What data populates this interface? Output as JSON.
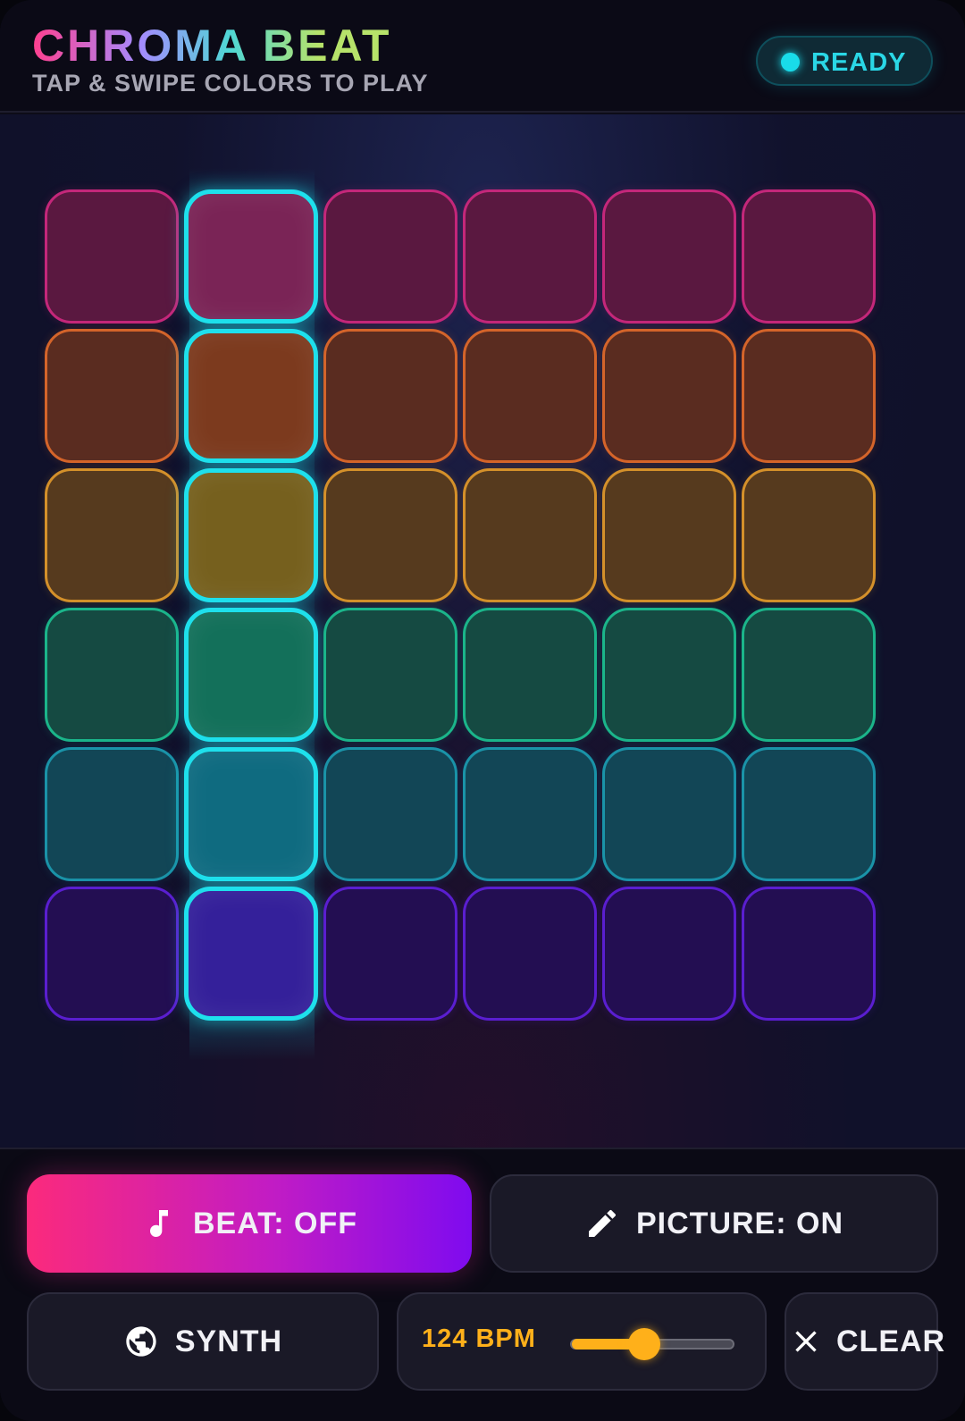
{
  "header": {
    "title": "CHROMA BEAT",
    "subtitle": "TAP & SWIPE COLORS TO PLAY",
    "status": "READY"
  },
  "grid": {
    "columns": 6,
    "active_column": 1,
    "rows": [
      {
        "name": "pink",
        "fill": "#5a1840",
        "active_fill": "#7a2456",
        "border": "#c4277a"
      },
      {
        "name": "orange",
        "fill": "#5a2c20",
        "active_fill": "#7c3a1e",
        "border": "#d4642a"
      },
      {
        "name": "amber",
        "fill": "#563a1e",
        "active_fill": "#76601e",
        "border": "#d4902a"
      },
      {
        "name": "green",
        "fill": "#154a42",
        "active_fill": "#13705a",
        "border": "#1bb58a"
      },
      {
        "name": "teal",
        "fill": "#124656",
        "active_fill": "#0f6b80",
        "border": "#1a93a8"
      },
      {
        "name": "violet",
        "fill": "#230e52",
        "active_fill": "#34209a",
        "border": "#5a1ed0"
      }
    ]
  },
  "controls": {
    "beat_label": "BEAT: OFF",
    "beat_icon": "music-note-icon",
    "picture_label": "PICTURE: ON",
    "picture_icon": "pencil-icon",
    "synth_label": "SYNTH",
    "synth_icon": "globe-icon",
    "bpm_label": "124 BPM",
    "tempo_level": 0.45,
    "clear_label": "CLEAR",
    "clear_icon": "close-icon"
  },
  "colors": {
    "accent_cyan": "#1ee0ec",
    "accent_amber": "#ffb01a",
    "beat_gradient_start": "#fb2a7c",
    "beat_gradient_end": "#7f0bef"
  }
}
